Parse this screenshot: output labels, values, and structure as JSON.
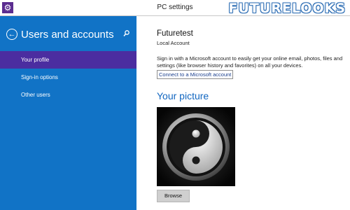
{
  "window": {
    "title": "PC settings",
    "app_icon": "gear-icon"
  },
  "watermark": {
    "text": "FUTURELOOKS"
  },
  "sidebar": {
    "back_icon": "back-arrow-icon",
    "title": "Users and accounts",
    "search_icon": "search-icon",
    "items": [
      {
        "label": "Your profile",
        "selected": true
      },
      {
        "label": "Sign-in options",
        "selected": false
      },
      {
        "label": "Other users",
        "selected": false
      }
    ]
  },
  "profile": {
    "name": "Futuretest",
    "account_type": "Local Account",
    "signin_text": "Sign in with a Microsoft account to easily get your online email, photos, files and settings (like browser history and favorites) on all your devices.",
    "connect_link": "Connect to a Microsoft account"
  },
  "picture_section": {
    "heading": "Your picture",
    "picture_icon": "yin-yang-icon",
    "browse_label": "Browse"
  },
  "colors": {
    "sidebar": "#1173c6",
    "selected": "#4b2da0",
    "accent": "#1166c0"
  }
}
